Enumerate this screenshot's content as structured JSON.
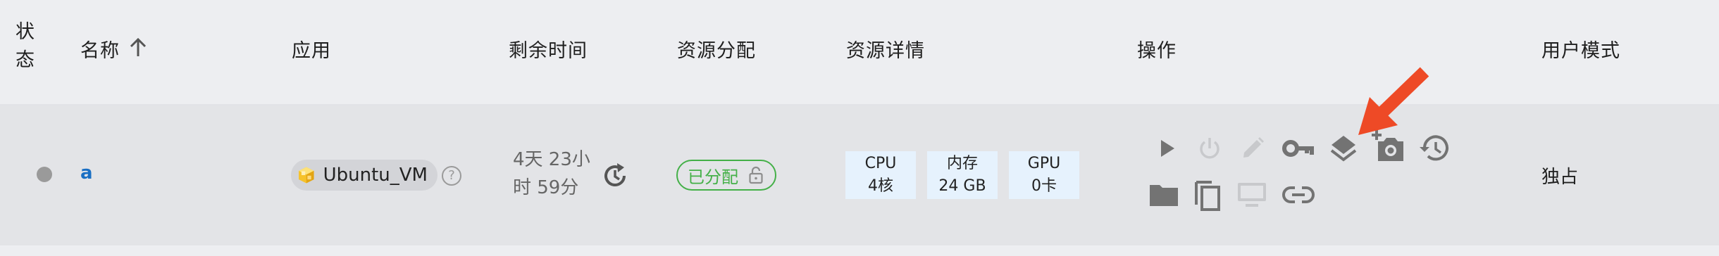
{
  "header": {
    "status": "状态",
    "name": "名称",
    "app": "应用",
    "remaining": "剩余时间",
    "allocation": "资源分配",
    "details": "资源详情",
    "actions": "操作",
    "user_mode": "用户模式"
  },
  "row": {
    "name": "a",
    "app_name": "Ubuntu_VM",
    "help": "?",
    "remaining_line1": "4天 23小",
    "remaining_line2": "时 59分",
    "allocation_badge": "已分配",
    "resources": [
      {
        "label": "CPU",
        "value": "4核"
      },
      {
        "label": "内存",
        "value": "24 GB"
      },
      {
        "label": "GPU",
        "value": "0卡"
      }
    ],
    "user_mode": "独占"
  },
  "icons": {
    "sort": "arrow-up-icon",
    "app": "ubuntu-cube-icon",
    "renew": "refresh-clock-icon",
    "lock": "lock-open-icon",
    "play": "play-icon",
    "power": "power-icon",
    "edit": "pencil-icon",
    "key": "key-icon",
    "layers": "layers-icon",
    "snapshot": "add-photo-icon",
    "history": "history-icon",
    "folder": "folder-icon",
    "copy": "copy-icon",
    "monitor": "monitor-icon",
    "link": "link-icon",
    "annotation": "red-arrow-annotation"
  },
  "colors": {
    "link": "#1a6fc4",
    "allocated_green": "#44b048",
    "resource_bg": "#e6f2fd",
    "arrow_red": "#ee4a26",
    "icon_active": "#737373",
    "icon_disabled": "#c8c9cc"
  }
}
